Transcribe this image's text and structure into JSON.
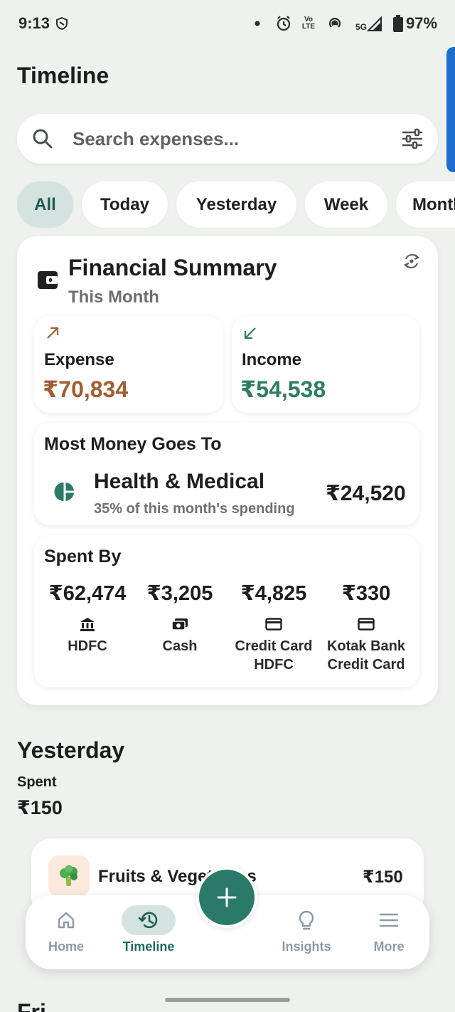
{
  "status_bar": {
    "time": "9:13",
    "network": "5G",
    "volte": "Vo LTE",
    "battery": "97%"
  },
  "page_title": "Timeline",
  "search": {
    "placeholder": "Search expenses..."
  },
  "filters": {
    "chips": [
      "All",
      "Today",
      "Yesterday",
      "Week",
      "Month"
    ],
    "active": "All"
  },
  "summary": {
    "title": "Financial Summary",
    "period": "This Month",
    "expense": {
      "label": "Expense",
      "value": "₹70,834",
      "color": "#a15d33"
    },
    "income": {
      "label": "Income",
      "value": "₹54,538",
      "color": "#2e7d62"
    },
    "top_category": {
      "heading": "Most Money Goes To",
      "name": "Health & Medical",
      "share": "35% of this month's spending",
      "amount": "₹24,520"
    },
    "spent_by": {
      "heading": "Spent By",
      "accounts": [
        {
          "amount": "₹62,474",
          "name": "HDFC",
          "icon": "bank-icon"
        },
        {
          "amount": "₹3,205",
          "name": "Cash",
          "icon": "cash-icon"
        },
        {
          "amount": "₹4,825",
          "name": "Credit Card HDFC",
          "icon": "credit-card-icon"
        },
        {
          "amount": "₹330",
          "name": "Kotak Bank Credit Card",
          "icon": "credit-card-icon"
        }
      ]
    }
  },
  "day_group": {
    "heading": "Yesterday",
    "spent_label": "Spent",
    "spent_value": "₹150",
    "transactions": [
      {
        "name": "Fruits & Vegetables",
        "amount": "₹150",
        "icon": "broccoli-icon"
      }
    ]
  },
  "next_group_heading": "Fri",
  "bottom_nav": {
    "items": [
      {
        "label": "Home",
        "icon": "home-icon"
      },
      {
        "label": "Timeline",
        "icon": "history-icon"
      },
      {
        "label": "Insights",
        "icon": "lightbulb-icon"
      },
      {
        "label": "More",
        "icon": "menu-icon"
      }
    ],
    "active": "Timeline"
  },
  "fab": {
    "icon": "plus-icon"
  },
  "colors": {
    "accent": "#2b7a69",
    "background": "#eef1ee",
    "active_chip": "#d4e3df"
  }
}
